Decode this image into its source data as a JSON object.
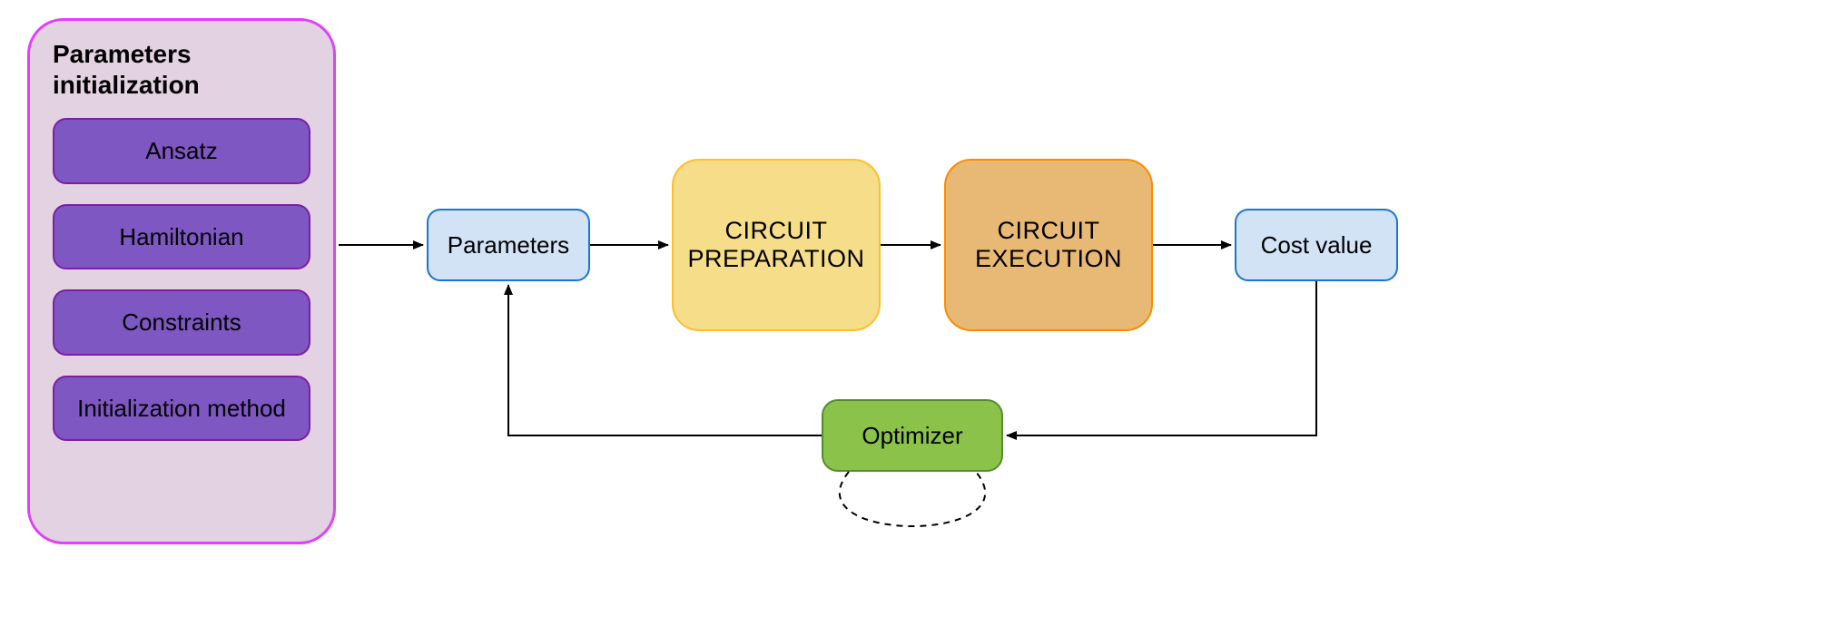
{
  "container": {
    "title": "Parameters initialization",
    "items": [
      "Ansatz",
      "Hamiltonian",
      "Constraints",
      "Initialization method"
    ]
  },
  "nodes": {
    "parameters": "Parameters",
    "circuit_preparation": "CIRCUIT PREPARATION",
    "circuit_execution": "CIRCUIT EXECUTION",
    "cost_value": "Cost value",
    "optimizer": "Optimizer"
  }
}
